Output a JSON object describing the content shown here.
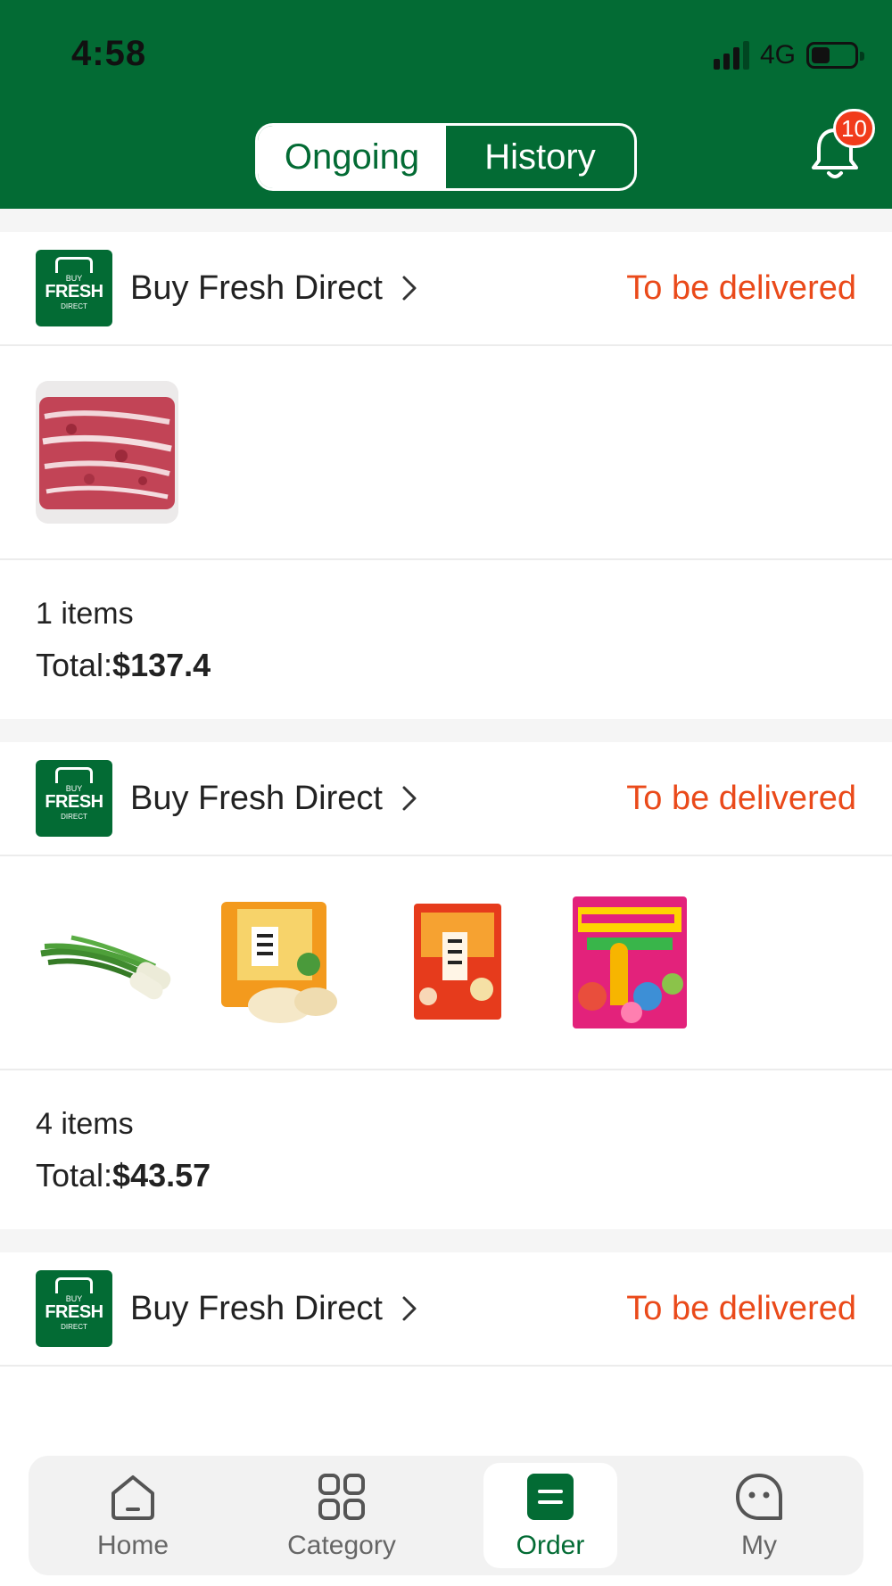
{
  "status_bar": {
    "time": "4:58",
    "network": "4G"
  },
  "tabs": [
    {
      "label": "Ongoing",
      "active": true
    },
    {
      "label": "History",
      "active": false
    }
  ],
  "notifications": {
    "badge": "10"
  },
  "colors": {
    "brand_green": "#036b34",
    "status_orange": "#ea4a1a",
    "badge_red": "#f13b1b"
  },
  "logo_text": {
    "top": "BUY",
    "middle": "FRESH",
    "bottom": "DIRECT"
  },
  "orders": [
    {
      "store": "Buy Fresh Direct",
      "status": "To be delivered",
      "items": [
        "beef-short-ribs-image"
      ],
      "count": "1 items",
      "total_label": "Total:",
      "total_value": "$137.4"
    },
    {
      "store": "Buy Fresh Direct",
      "status": "To be delivered",
      "items": [
        "green-onion-image",
        "rice-cracker-bag-image",
        "rice-cracker-snow-image",
        "cream-animals-biscuit-image"
      ],
      "count": "4 items",
      "total_label": "Total:",
      "total_value": "$43.57"
    },
    {
      "store": "Buy Fresh Direct",
      "status": "To be delivered"
    }
  ],
  "bottom_nav": [
    {
      "label": "Home",
      "icon": "home-icon",
      "active": false
    },
    {
      "label": "Category",
      "icon": "category-icon",
      "active": false
    },
    {
      "label": "Order",
      "icon": "order-icon",
      "active": true
    },
    {
      "label": "My",
      "icon": "my-icon",
      "active": false
    }
  ]
}
